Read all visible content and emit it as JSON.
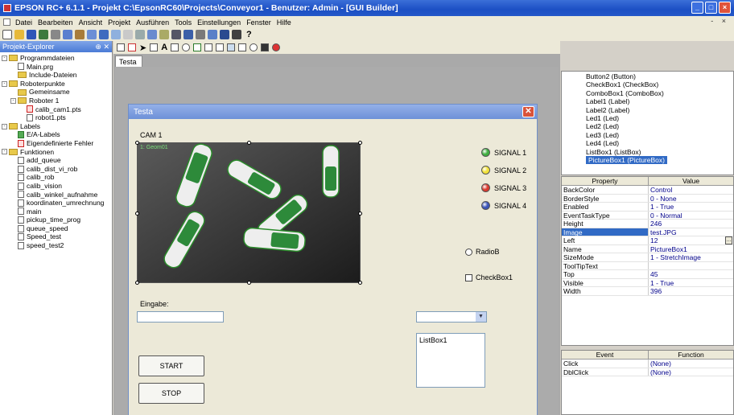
{
  "window": {
    "title": "EPSON RC+ 6.1.1 - Projekt C:\\EpsonRC60\\Projects\\Conveyor1 - Benutzer: Admin - [GUI Builder]"
  },
  "menu": [
    "Datei",
    "Bearbeiten",
    "Ansicht",
    "Projekt",
    "Ausführen",
    "Tools",
    "Einstellungen",
    "Fenster",
    "Hilfe"
  ],
  "toolbar": {
    "help_glyph": "?"
  },
  "explorer": {
    "title": "Projekt-Explorer",
    "pin": "ᅠ✕",
    "tree": [
      {
        "label": "Programmdateien",
        "level": 0,
        "type": "folder",
        "exp": "-"
      },
      {
        "label": "Main.prg",
        "level": 1,
        "type": "file"
      },
      {
        "label": "Include-Dateien",
        "level": 1,
        "type": "folder"
      },
      {
        "label": "Roboterpunkte",
        "level": 0,
        "type": "folder",
        "exp": "-"
      },
      {
        "label": "Gemeinsame",
        "level": 1,
        "type": "folder"
      },
      {
        "label": "Roboter 1",
        "level": 1,
        "type": "folder",
        "exp": "-"
      },
      {
        "label": "calib_cam1.pts",
        "level": 2,
        "type": "file-red"
      },
      {
        "label": "robot1.pts",
        "level": 2,
        "type": "file"
      },
      {
        "label": "Labels",
        "level": 0,
        "type": "folder",
        "exp": "-"
      },
      {
        "label": "E/A-Labels",
        "level": 1,
        "type": "file-lbl"
      },
      {
        "label": "Eigendefinierte Fehler",
        "level": 1,
        "type": "file-red"
      },
      {
        "label": "Funktionen",
        "level": 0,
        "type": "folder",
        "exp": "-"
      },
      {
        "label": "add_queue",
        "level": 1,
        "type": "file"
      },
      {
        "label": "calib_dist_vi_rob",
        "level": 1,
        "type": "file"
      },
      {
        "label": "calib_rob",
        "level": 1,
        "type": "file"
      },
      {
        "label": "calib_vision",
        "level": 1,
        "type": "file"
      },
      {
        "label": "calib_winkel_aufnahme",
        "level": 1,
        "type": "file"
      },
      {
        "label": "koordinaten_umrechnung",
        "level": 1,
        "type": "file"
      },
      {
        "label": "main",
        "level": 1,
        "type": "file"
      },
      {
        "label": "pickup_time_prog",
        "level": 1,
        "type": "file"
      },
      {
        "label": "queue_speed",
        "level": 1,
        "type": "file"
      },
      {
        "label": "Speed_test",
        "level": 1,
        "type": "file"
      },
      {
        "label": "speed_test2",
        "level": 1,
        "type": "file"
      }
    ]
  },
  "document": {
    "tab": "Testa"
  },
  "form": {
    "title": "Testa",
    "close": "✕",
    "cam_label": "CAM 1",
    "picture_overlay": "1: Geom01",
    "signals": [
      {
        "label": "SIGNAL 1",
        "color": "#3fae3f"
      },
      {
        "label": "SIGNAL 2",
        "color": "#f2e23a"
      },
      {
        "label": "SIGNAL 3",
        "color": "#d93a2f"
      },
      {
        "label": "SIGNAL 4",
        "color": "#3b55b8"
      }
    ],
    "radio_label": "RadioB",
    "checkbox_label": "CheckBox1",
    "eingabe_label": "Eingabe:",
    "combo_arrow": "▼",
    "listbox_label": "ListBox1",
    "start_label": "START",
    "stop_label": "STOP"
  },
  "controls": [
    "Button2 (Button)",
    "CheckBox1 (CheckBox)",
    "ComboBox1 (ComboBox)",
    "Label1 (Label)",
    "Label2 (Label)",
    "Led1 (Led)",
    "Led2 (Led)",
    "Led3 (Led)",
    "Led4 (Led)",
    "ListBox1 (ListBox)",
    "PictureBox1 (PictureBox)"
  ],
  "controls_selected": "PictureBox1 (PictureBox)",
  "properties": {
    "header": [
      "Property",
      "Value"
    ],
    "rows": [
      [
        "BackColor",
        "Control"
      ],
      [
        "BorderStyle",
        "0 - None"
      ],
      [
        "Enabled",
        "1 - True"
      ],
      [
        "EventTaskType",
        "0 - Normal"
      ],
      [
        "Height",
        "246"
      ],
      [
        "Image",
        "test.JPG"
      ],
      [
        "Left",
        "12"
      ],
      [
        "Name",
        "PictureBox1"
      ],
      [
        "SizeMode",
        "1 - StretchImage"
      ],
      [
        "ToolTipText",
        ""
      ],
      [
        "Top",
        "45"
      ],
      [
        "Visible",
        "1 - True"
      ],
      [
        "Width",
        "396"
      ]
    ],
    "selected": "Image"
  },
  "events": {
    "header": [
      "Event",
      "Function"
    ],
    "rows": [
      [
        "Click",
        "(None)"
      ],
      [
        "DblClick",
        "(None)"
      ]
    ]
  }
}
